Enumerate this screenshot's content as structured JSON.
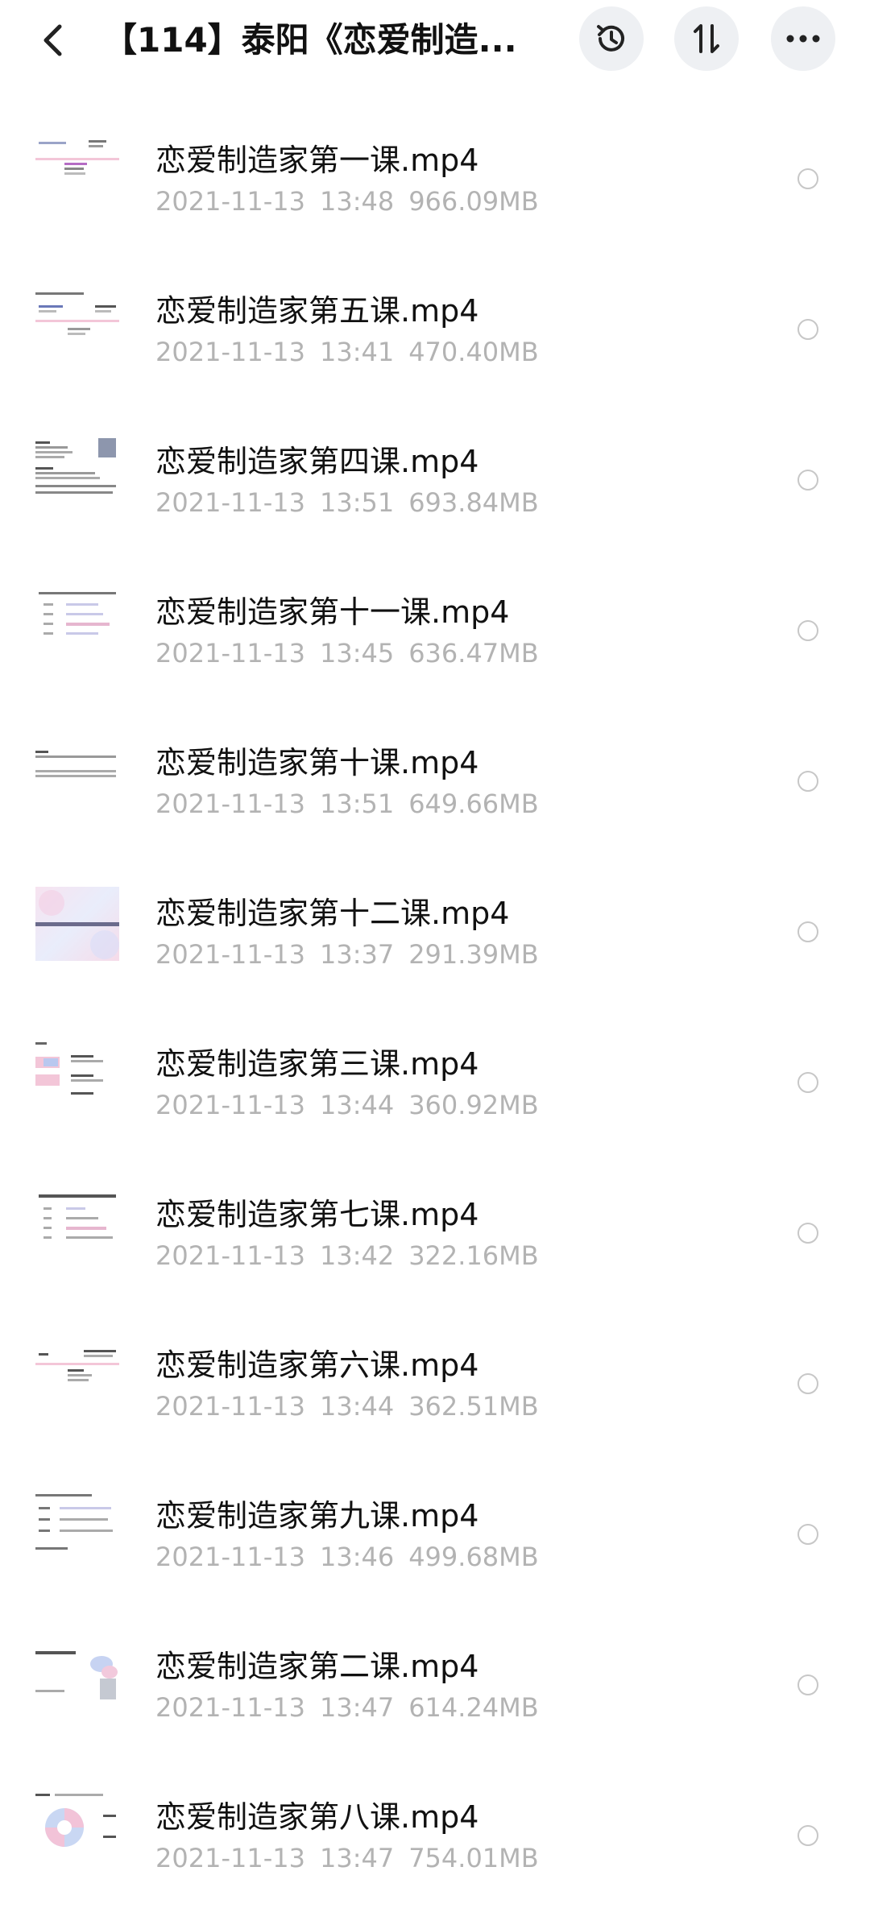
{
  "header": {
    "title": "【114】泰阳《恋爱制造...",
    "back_icon": "chevron-left-icon",
    "history_icon": "history-clock-icon",
    "sort_icon": "sort-icon",
    "more_icon": "more-horizontal-icon"
  },
  "files": [
    {
      "name": "恋爱制造家第一课.mp4",
      "date": "2021-11-13",
      "time": "13:48",
      "size": "966.09MB"
    },
    {
      "name": "恋爱制造家第五课.mp4",
      "date": "2021-11-13",
      "time": "13:41",
      "size": "470.40MB"
    },
    {
      "name": "恋爱制造家第四课.mp4",
      "date": "2021-11-13",
      "time": "13:51",
      "size": "693.84MB"
    },
    {
      "name": "恋爱制造家第十一课.mp4",
      "date": "2021-11-13",
      "time": "13:45",
      "size": "636.47MB"
    },
    {
      "name": "恋爱制造家第十课.mp4",
      "date": "2021-11-13",
      "time": "13:51",
      "size": "649.66MB"
    },
    {
      "name": "恋爱制造家第十二课.mp4",
      "date": "2021-11-13",
      "time": "13:37",
      "size": "291.39MB"
    },
    {
      "name": "恋爱制造家第三课.mp4",
      "date": "2021-11-13",
      "time": "13:44",
      "size": "360.92MB"
    },
    {
      "name": "恋爱制造家第七课.mp4",
      "date": "2021-11-13",
      "time": "13:42",
      "size": "322.16MB"
    },
    {
      "name": "恋爱制造家第六课.mp4",
      "date": "2021-11-13",
      "time": "13:44",
      "size": "362.51MB"
    },
    {
      "name": "恋爱制造家第九课.mp4",
      "date": "2021-11-13",
      "time": "13:46",
      "size": "499.68MB"
    },
    {
      "name": "恋爱制造家第二课.mp4",
      "date": "2021-11-13",
      "time": "13:47",
      "size": "614.24MB"
    },
    {
      "name": "恋爱制造家第八课.mp4",
      "date": "2021-11-13",
      "time": "13:47",
      "size": "754.01MB"
    }
  ],
  "colors": {
    "meta_text": "#b3b3b3",
    "header_button_bg": "#eef0f3",
    "radio_border": "#c7c7c7"
  }
}
